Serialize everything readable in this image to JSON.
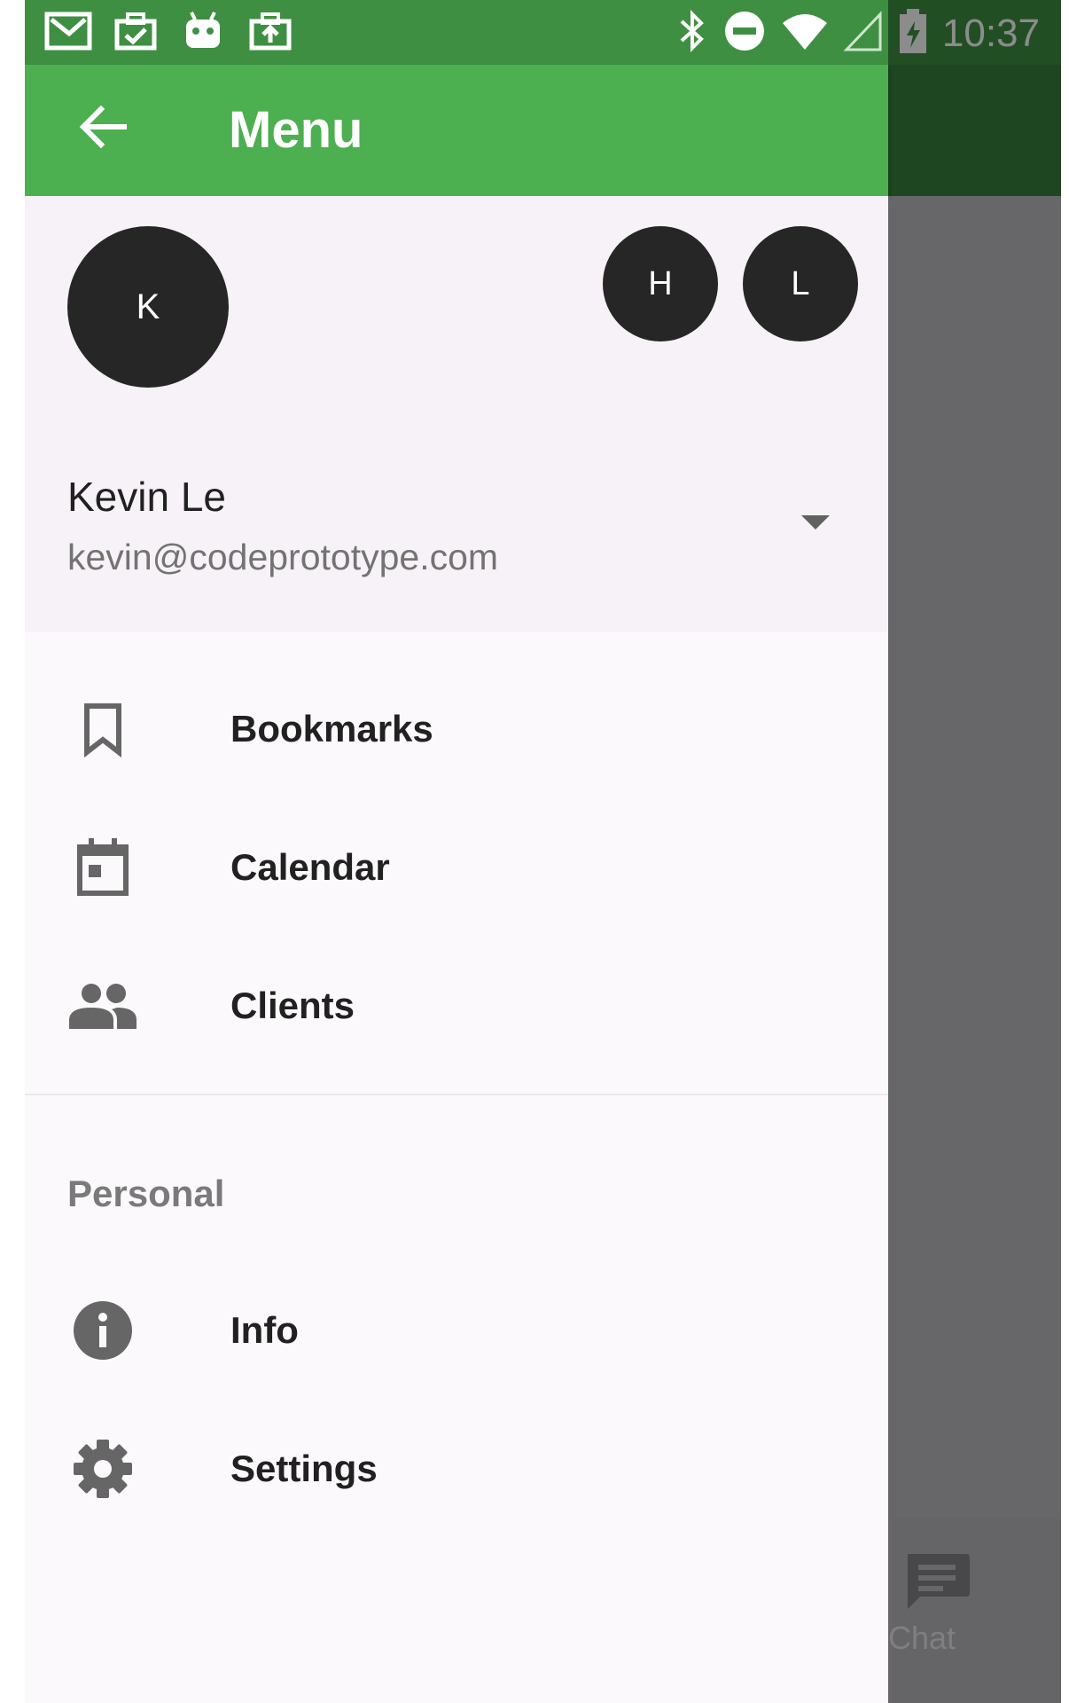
{
  "status_bar": {
    "time": "10:37",
    "left_icons": [
      "gmail-icon",
      "task-done-icon",
      "android-icon",
      "upload-icon"
    ],
    "right_icons": [
      "bluetooth-icon",
      "do-not-disturb-icon",
      "wifi-icon",
      "cell-signal-icon",
      "battery-charging-icon"
    ]
  },
  "app_bar": {
    "title": "Menu",
    "back_icon": "arrow-back-icon",
    "color": "#4caf50"
  },
  "account": {
    "avatar_initial": "K",
    "other_accounts": [
      "H",
      "L"
    ],
    "name": "Kevin Le",
    "email": "kevin@codeprototype.com"
  },
  "menu": {
    "items": [
      {
        "label": "Bookmarks",
        "icon": "bookmark-icon"
      },
      {
        "label": "Calendar",
        "icon": "calendar-icon"
      },
      {
        "label": "Clients",
        "icon": "people-icon"
      }
    ],
    "section_title": "Personal",
    "personal_items": [
      {
        "label": "Info",
        "icon": "info-icon"
      },
      {
        "label": "Settings",
        "icon": "settings-icon"
      }
    ]
  },
  "background": {
    "bottom_tab_label": "Chat",
    "bottom_tab_icon": "chat-icon"
  }
}
